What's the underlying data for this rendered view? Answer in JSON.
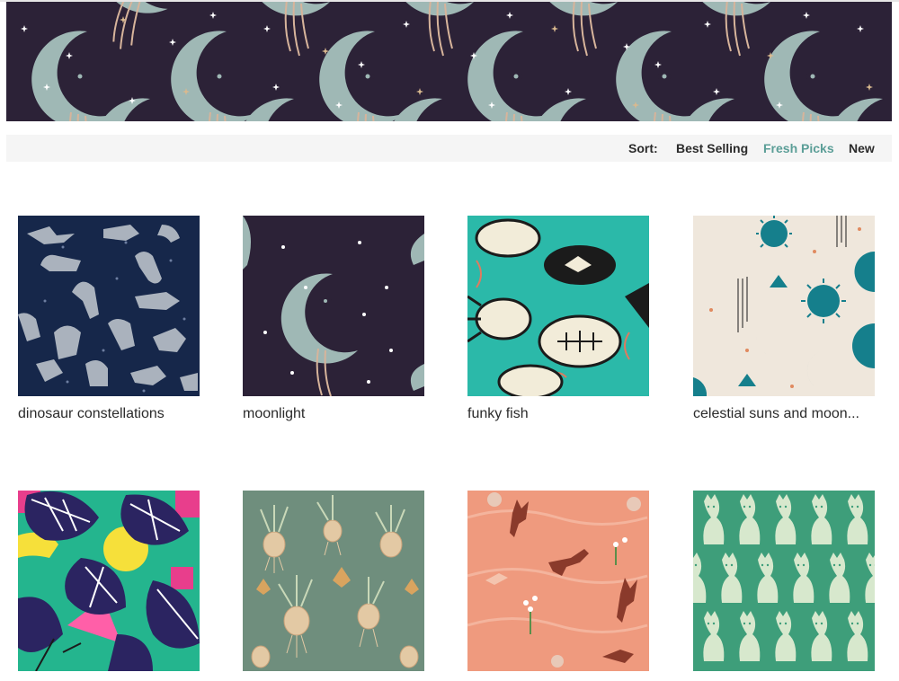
{
  "sort": {
    "label": "Sort:",
    "options": [
      "Best Selling",
      "Fresh Picks",
      "New"
    ],
    "active": "Fresh Picks"
  },
  "products": [
    {
      "title": "dinosaur constellations"
    },
    {
      "title": "moonlight"
    },
    {
      "title": "funky fish"
    },
    {
      "title": "celestial suns and moon..."
    },
    {
      "title": ""
    },
    {
      "title": ""
    },
    {
      "title": ""
    },
    {
      "title": ""
    }
  ],
  "colors": {
    "accent": "#5b9e97",
    "banner_bg": "#2c2237",
    "sortbar_bg": "#f5f5f5"
  }
}
